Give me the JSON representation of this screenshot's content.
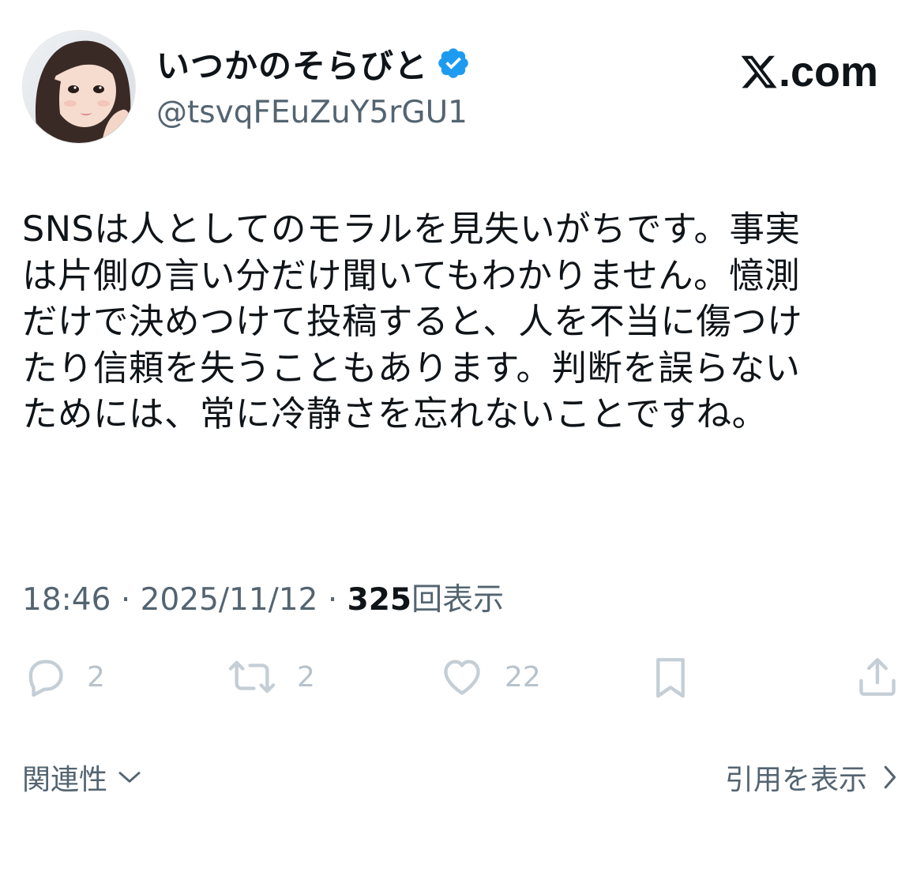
{
  "author": {
    "display_name": "いつかのそらびと",
    "handle": "@tsvqFEuZuY5rGU1",
    "verified": true,
    "avatar": "profile-photo"
  },
  "brand": {
    "label": ".com",
    "icon": "x-logo-icon"
  },
  "tweet": {
    "text": "SNSは人としてのモラルを見失いがちです。事実\nは片側の言い分だけ聞いてもわかりません。憶測\nだけで決めつけて投稿すると、人を不当に傷つけ\nたり信頼を失うこともあります。判断を誤らない\nためには、常に冷静さを忘れないことですね。"
  },
  "meta": {
    "time": "18:46",
    "separator": "·",
    "date": "2025/11/12",
    "views_count": "325",
    "views_label": "回表示"
  },
  "actions": {
    "reply_count": "2",
    "repost_count": "2",
    "like_count": "22"
  },
  "footer": {
    "related_label": "関連性",
    "quotes_label": "引用を表示"
  },
  "colors": {
    "text": "#0f1419",
    "secondary": "#536471",
    "action_icon": "#c4ced6",
    "verified": "#1d9bf0"
  }
}
